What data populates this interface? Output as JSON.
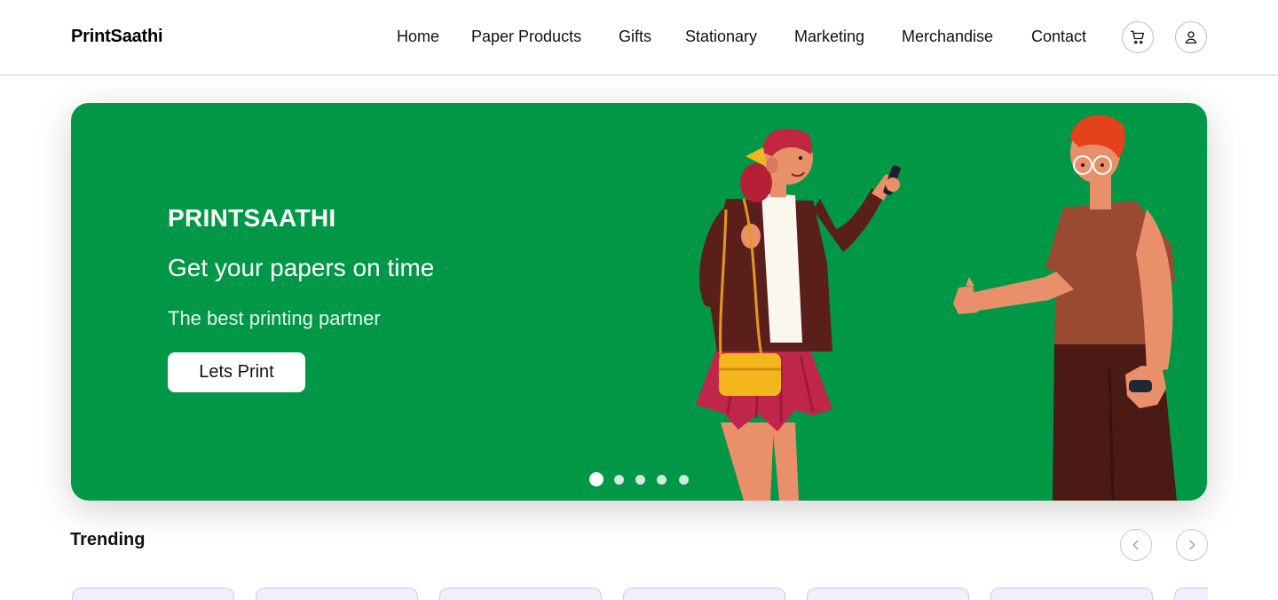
{
  "header": {
    "brand": "PrintSaathi",
    "nav": [
      "Home",
      "Paper Products",
      "Gifts",
      "Stationary",
      "Marketing",
      "Merchandise",
      "Contact"
    ],
    "cart_icon": "cart-icon",
    "user_icon": "user-icon"
  },
  "hero": {
    "brand": "PRINTSAATHI",
    "title": "Get your papers on time",
    "subtitle": "The best printing partner",
    "cta": "Lets Print",
    "background": "#009846",
    "slides": 5,
    "active_slide": 1
  },
  "trending": {
    "title": "Trending",
    "prev_icon": "chevron-left-icon",
    "next_icon": "chevron-right-icon",
    "cards_visible": 7
  }
}
